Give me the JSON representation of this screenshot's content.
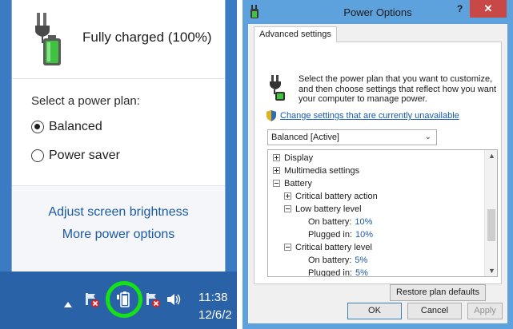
{
  "flyout": {
    "status": "Fully charged (100%)",
    "plan_header": "Select a power plan:",
    "plans": [
      {
        "label": "Balanced",
        "selected": true
      },
      {
        "label": "Power saver",
        "selected": false
      }
    ],
    "links": {
      "brightness": "Adjust screen brightness",
      "more": "More power options"
    },
    "battery_icon": "battery-full-icon"
  },
  "taskbar": {
    "icons": [
      "chevron-up-icon",
      "network-error-icon",
      "battery-icon",
      "action-center-icon",
      "speaker-icon"
    ],
    "clock_time": "11:38",
    "clock_date": "12/6/2",
    "highlight_color": "#16e016"
  },
  "dialog": {
    "title": "Power Options",
    "help": "?",
    "close": "✕",
    "tab": "Advanced settings",
    "intro": "Select the power plan that you want to customize, and then choose settings that reflect how you want your computer to manage power.",
    "change_link": "Change settings that are currently unavailable",
    "plan_select": "Balanced [Active]",
    "tree": [
      {
        "label": "Display",
        "level": 0,
        "expanded": false
      },
      {
        "label": "Multimedia settings",
        "level": 0,
        "expanded": false
      },
      {
        "label": "Battery",
        "level": 0,
        "expanded": true
      },
      {
        "label": "Critical battery action",
        "level": 1,
        "expanded": false
      },
      {
        "label": "Low battery level",
        "level": 1,
        "expanded": true
      },
      {
        "label": "On battery:",
        "value": "10%",
        "level": 2
      },
      {
        "label": "Plugged in:",
        "value": "10%",
        "level": 2
      },
      {
        "label": "Critical battery level",
        "level": 1,
        "expanded": true
      },
      {
        "label": "On battery:",
        "value": "5%",
        "level": 2
      },
      {
        "label": "Plugged in:",
        "value": "5%",
        "level": 2
      }
    ],
    "restore": "Restore plan defaults",
    "ok": "OK",
    "cancel": "Cancel",
    "apply": "Apply"
  }
}
